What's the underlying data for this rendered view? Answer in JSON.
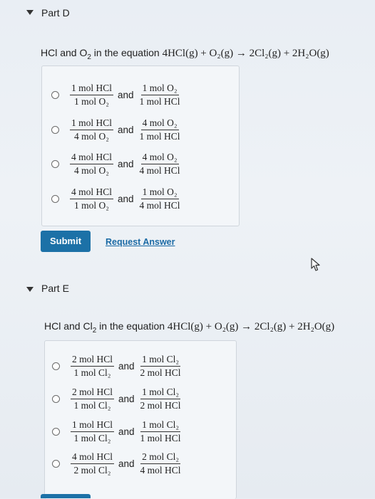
{
  "partD": {
    "label": "Part D",
    "question_prefix": "HCl and O",
    "question_prefix_sub": "2",
    "question_mid": " in the equation ",
    "equation": "4HCl(g) + O₂(g) → 2Cl₂(g) + 2H₂O(g)",
    "options": [
      {
        "f1_num": "1 mol HCl",
        "f1_den": "1 mol O₂",
        "f2_num": "1 mol O₂",
        "f2_den": "1 mol HCl"
      },
      {
        "f1_num": "1 mol HCl",
        "f1_den": "4 mol O₂",
        "f2_num": "4 mol O₂",
        "f2_den": "1 mol HCl"
      },
      {
        "f1_num": "4 mol HCl",
        "f1_den": "4 mol O₂",
        "f2_num": "4 mol O₂",
        "f2_den": "4 mol HCl"
      },
      {
        "f1_num": "4 mol HCl",
        "f1_den": "1 mol O₂",
        "f2_num": "1 mol O₂",
        "f2_den": "4 mol HCl"
      }
    ],
    "and_word": "and",
    "submit_label": "Submit",
    "request_label": "Request Answer"
  },
  "partE": {
    "label": "Part E",
    "question_prefix": "HCl and Cl",
    "question_prefix_sub": "2",
    "question_mid": " in the equation ",
    "equation": "4HCl(g) + O₂(g) → 2Cl₂(g) + 2H₂O(g)",
    "options": [
      {
        "f1_num": "2 mol HCl",
        "f1_den": "1 mol Cl₂",
        "f2_num": "1 mol Cl₂",
        "f2_den": "2 mol HCl"
      },
      {
        "f1_num": "2 mol HCl",
        "f1_den": "1 mol Cl₂",
        "f2_num": "1 mol Cl₂",
        "f2_den": "2 mol HCl"
      },
      {
        "f1_num": "1 mol HCl",
        "f1_den": "1 mol Cl₂",
        "f2_num": "1 mol Cl₂",
        "f2_den": "1 mol HCl"
      },
      {
        "f1_num": "4 mol HCl",
        "f1_den": "2 mol Cl₂",
        "f2_num": "2 mol Cl₂",
        "f2_den": "4 mol HCl"
      }
    ],
    "and_word": "and"
  }
}
